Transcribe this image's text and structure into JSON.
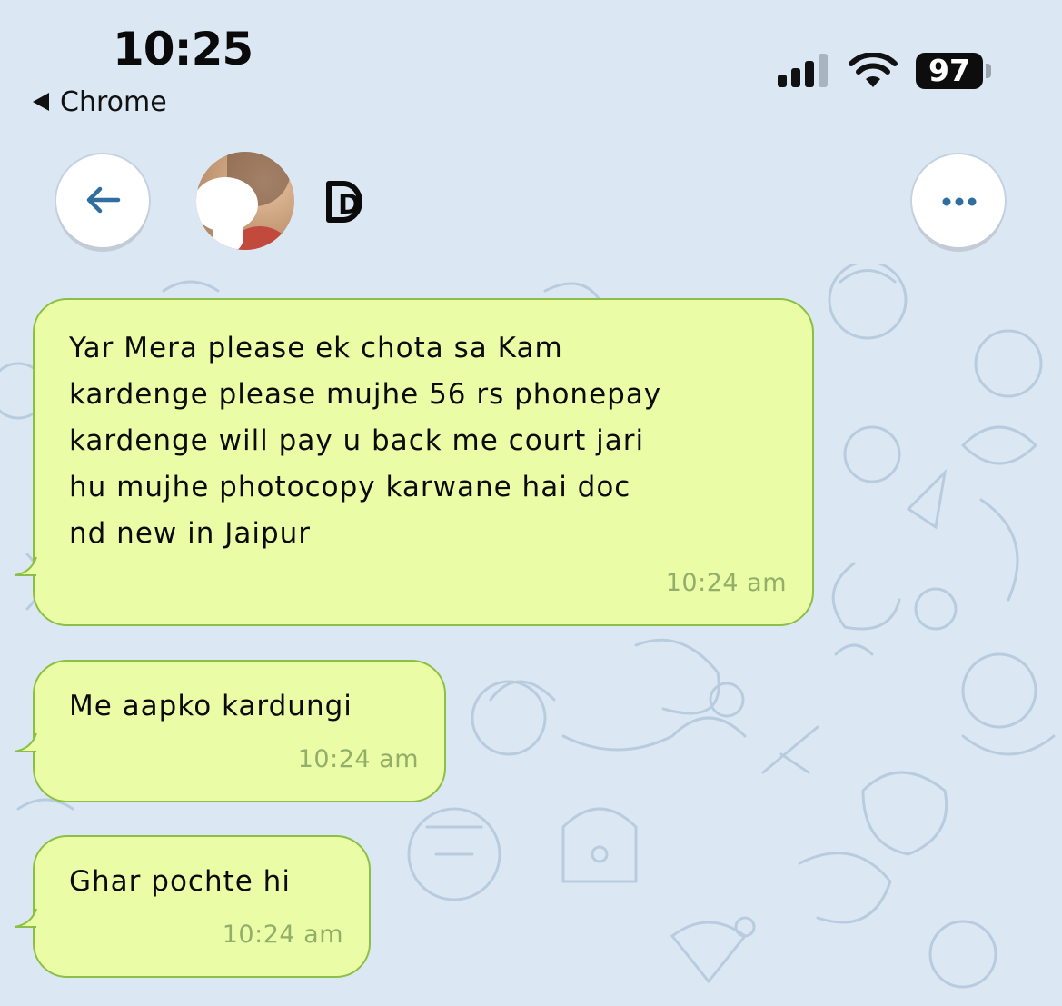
{
  "status_bar": {
    "time": "10:25",
    "back_app": "Chrome",
    "battery": "97",
    "icons": [
      "signal-icon",
      "wifi-icon",
      "battery-icon"
    ]
  },
  "header": {
    "back_icon": "arrow-left-icon",
    "contact_initial": "D",
    "more_icon": "ellipsis-icon"
  },
  "messages": [
    {
      "text": "Yar Mera please ek chota sa Kam\nkardenge please mujhe 56 rs phonepay\nkardenge will pay u back me court jari\nhu mujhe photocopy karwane hai doc\nnd new in Jaipur",
      "time": "10:24 am"
    },
    {
      "text": "Me aapko kardungi",
      "time": "10:24 am"
    },
    {
      "text": "Ghar pochte hi",
      "time": "10:24 am"
    }
  ],
  "colors": {
    "background": "#dbe8f4",
    "bubble_fill": "#eafda6",
    "bubble_border": "#8cbf45",
    "timestamp": "#93ae69",
    "accent_icon": "#2f6e9f"
  }
}
